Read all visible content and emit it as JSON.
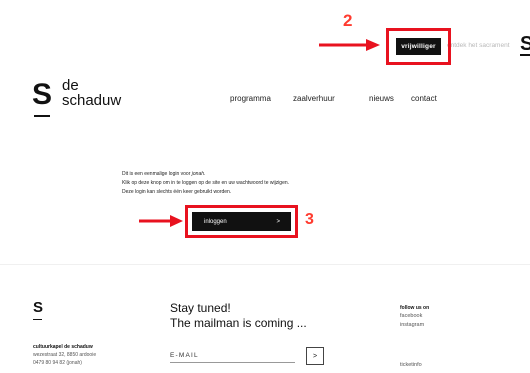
{
  "annotations": {
    "step_top": "2",
    "step_login": "3",
    "color": "#e8121f"
  },
  "topbar": {
    "volunteer_label": "vrijwilliger",
    "sacrament_link": "ontdek het sacrament",
    "logo_letter": "S"
  },
  "header": {
    "logo_letter": "S",
    "logo_line1": "de",
    "logo_line2": "schaduw",
    "nav": [
      "programma",
      "zaalverhuur",
      "nieuws",
      "contact"
    ]
  },
  "login": {
    "line1_prefix": "Dit is een eenmalige login voor ",
    "line1_user": "jonah",
    "line1_suffix": ".",
    "line2": "Klik op deze knop om in te loggen op de site en uw wachtwoord te wijzigen.",
    "line3": "Deze login kan slechts één keer gebruikt worden.",
    "button_label": "inloggen",
    "button_arrow": ">"
  },
  "footer": {
    "logo_letter": "S",
    "org_name": "cultuurkapel de schaduw",
    "address": "wezestraat 32, 8850 ardooie",
    "phone": "0479 80 94 82 (jonah)",
    "newsletter_line1": "Stay tuned!",
    "newsletter_line2": "The mailman is coming ...",
    "email_placeholder": "E-MAIL",
    "submit_arrow": ">",
    "follow_title": "follow us on",
    "social": [
      "facebook",
      "instagram"
    ],
    "ticketinfo": "ticketinfo"
  }
}
